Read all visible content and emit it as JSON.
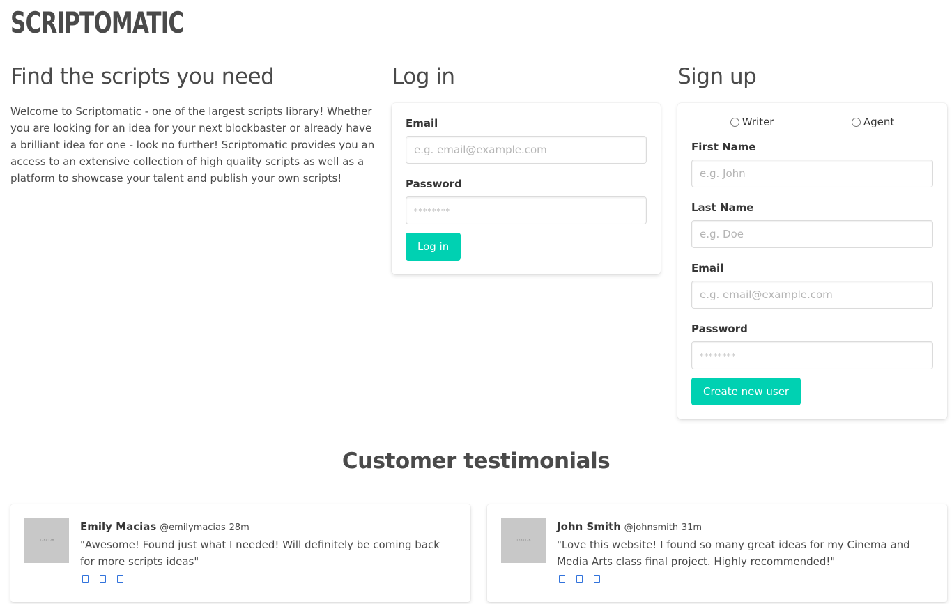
{
  "brand": "SCRIPTOMATIC",
  "intro": {
    "title": "Find the scripts you need",
    "text": "Welcome to Scriptomatic - one of the largest scripts library! Whether you are looking for an idea for your next blockbaster or already have a brilliant idea for one - look no further! Scriptomatic provides you an access to an extensive collection of high quality scripts as well as a platform to showcase your talent and publish your own scripts!"
  },
  "login": {
    "title": "Log in",
    "email_label": "Email",
    "email_placeholder": "e.g. email@example.com",
    "password_label": "Password",
    "password_placeholder": "********",
    "submit_label": "Log in"
  },
  "signup": {
    "title": "Sign up",
    "role_writer": "Writer",
    "role_agent": "Agent",
    "first_name_label": "First Name",
    "first_name_placeholder": "e.g. John",
    "last_name_label": "Last Name",
    "last_name_placeholder": "e.g. Doe",
    "email_label": "Email",
    "email_placeholder": "e.g. email@example.com",
    "password_label": "Password",
    "password_placeholder": "********",
    "submit_label": "Create new user"
  },
  "testimonials": {
    "title": "Customer testimonials",
    "items": [
      {
        "name": "Emily Macias",
        "handle": "@emilymacias",
        "time": "28m",
        "quote": "\"Awesome! Found just what I needed! Will definitely be coming back for more scripts ideas\"",
        "avatar_text": "128×128"
      },
      {
        "name": "John Smith",
        "handle": "@johnsmith",
        "time": "31m",
        "quote": "\"Love this website! I found so many great ideas for my Cinema and Media Arts class final project. Highly recommended!\"",
        "avatar_text": "128×128"
      }
    ]
  },
  "colors": {
    "primary": "#00d1b2",
    "link": "#3273dc",
    "text": "#4a4a4a"
  },
  "icons": [
    "reply-icon",
    "retweet-icon",
    "like-icon"
  ]
}
